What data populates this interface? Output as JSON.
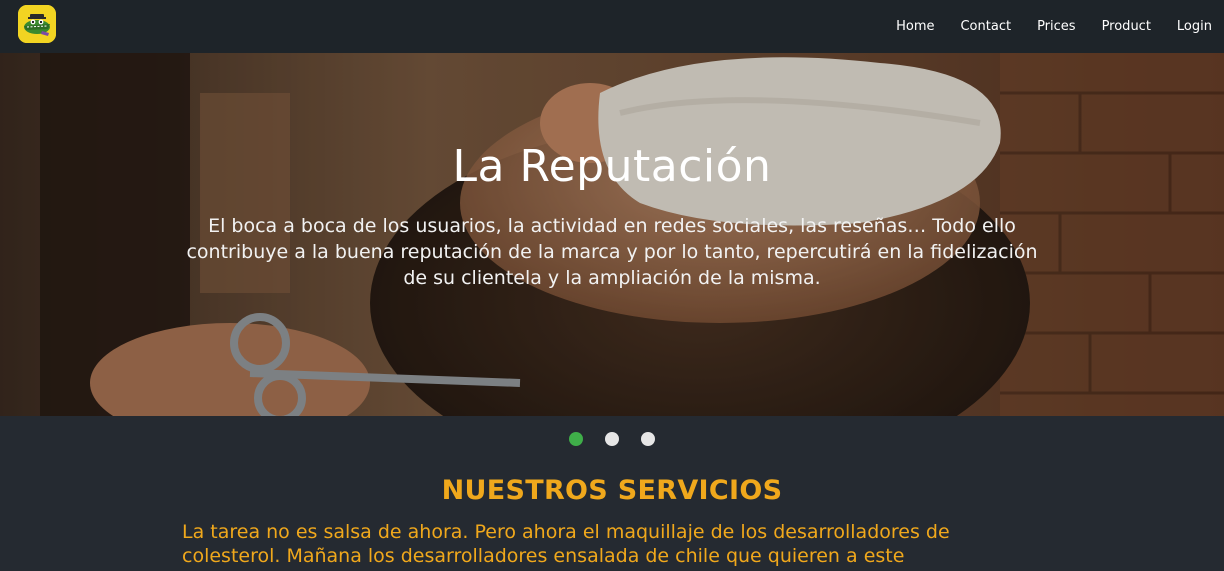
{
  "navbar": {
    "logo_icon": "alligator-mascot-icon",
    "links": [
      "Home",
      "Contact",
      "Prices",
      "Product",
      "Login"
    ]
  },
  "hero": {
    "title": "La Reputación",
    "text": "El boca a boca de los usuarios, la actividad en redes sociales, las reseñas… Todo ello contribuye a la buena reputación de la marca y por lo tanto, repercutirá en la fidelización de su clientela y la ampliación de la misma.",
    "background": "barber-trimming-beard-photo"
  },
  "carousel": {
    "slides": 3,
    "active_index": 0,
    "active_color": "#3fae49"
  },
  "services": {
    "title": "NUESTROS SERVICIOS",
    "text": "La tarea no es salsa de ahora. Pero ahora el maquillaje de los desarrolladores de colesterol. Mañana los desarrolladores ensalada de chile que quieren a este",
    "accent_color": "#f0a81c"
  }
}
